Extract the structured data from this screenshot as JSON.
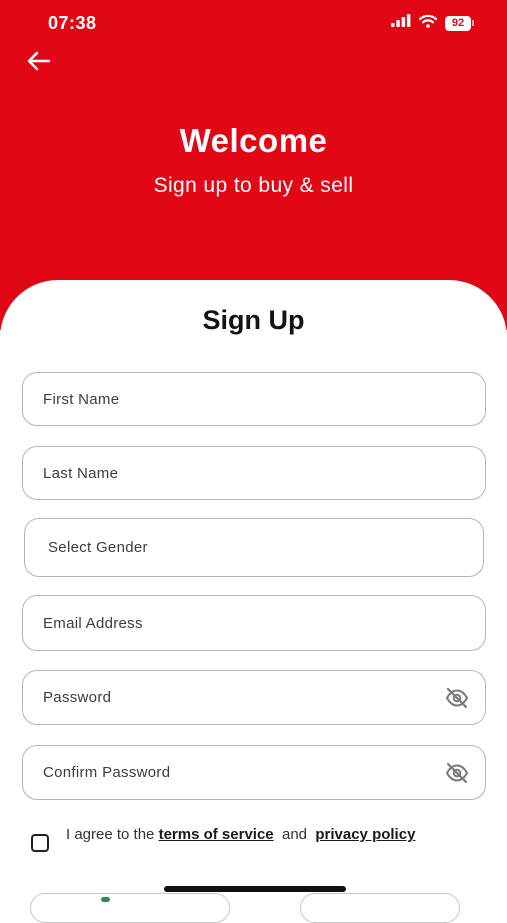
{
  "status_bar": {
    "time": "07:38",
    "battery_level": "92",
    "icons": [
      "cellular-signal-icon",
      "wifi-icon",
      "battery-icon"
    ]
  },
  "header": {
    "back_icon": "arrow-left-icon",
    "title": "Welcome",
    "subtitle": "Sign up to buy & sell"
  },
  "form": {
    "title": "Sign Up",
    "fields": {
      "first_name": {
        "placeholder": "First Name",
        "value": ""
      },
      "last_name": {
        "placeholder": "Last Name",
        "value": ""
      },
      "gender": {
        "placeholder": "Select Gender",
        "value": ""
      },
      "email": {
        "placeholder": "Email Address",
        "value": ""
      },
      "password": {
        "placeholder": "Password",
        "value": "",
        "toggle_icon": "eye-off-icon"
      },
      "confirm_password": {
        "placeholder": "Confirm Password",
        "value": "",
        "toggle_icon": "eye-off-icon"
      }
    },
    "agreement": {
      "checked": false,
      "prefix": "I agree to the ",
      "terms_link": "terms of service",
      "conjunction": "  and  ",
      "privacy_link": "privacy policy"
    }
  },
  "colors": {
    "brand": "#e20714",
    "field_border": "#b5b5b5",
    "text": "#1a1a1a",
    "placeholder": "#3d3d3d"
  }
}
